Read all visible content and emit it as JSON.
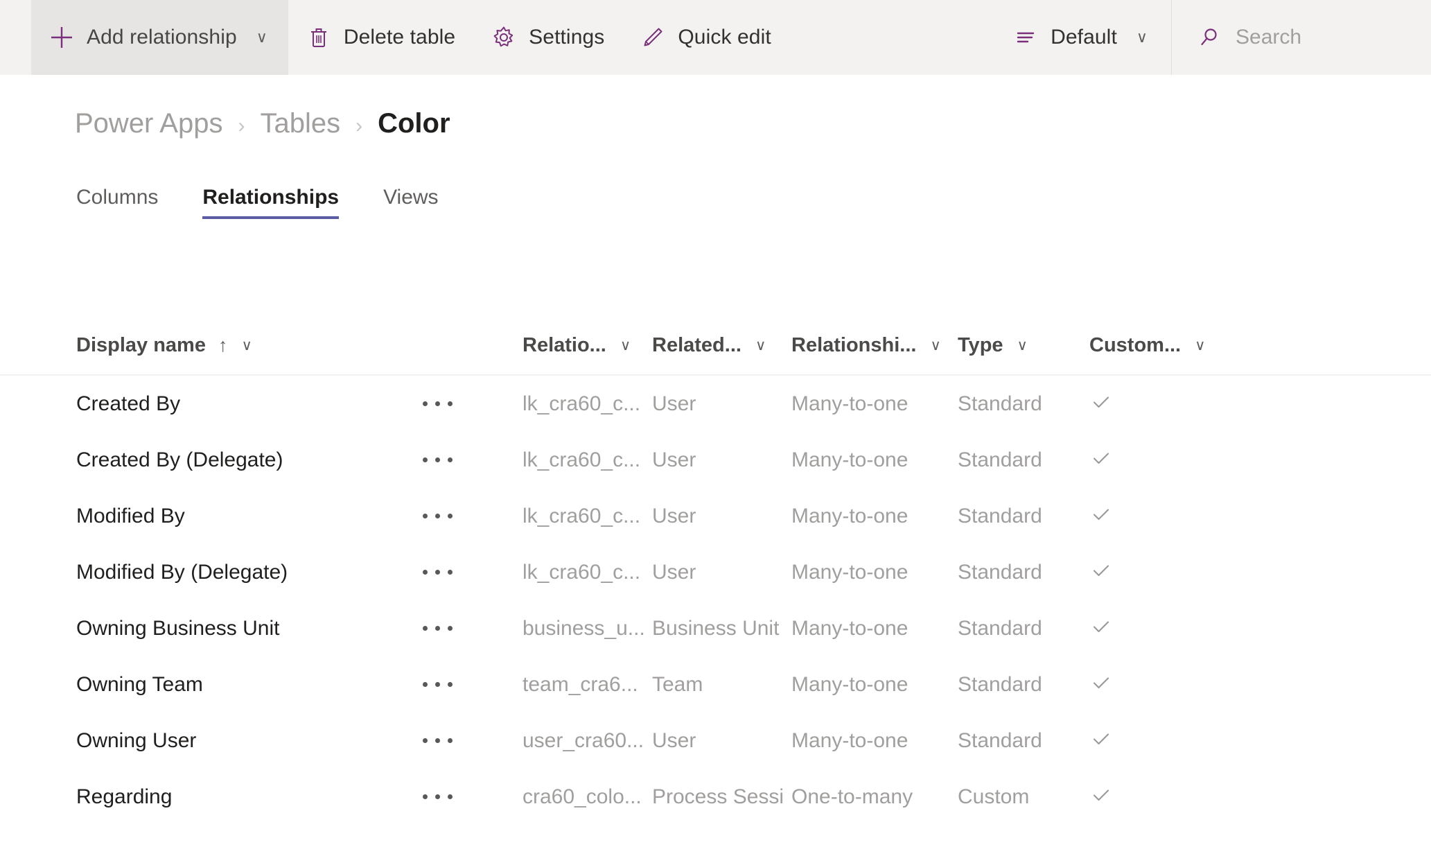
{
  "commandbar": {
    "add_relationship": {
      "label": "Add relationship",
      "icon": "plus-icon",
      "caret": "∨"
    },
    "delete_table": {
      "label": "Delete table",
      "icon": "trash-icon"
    },
    "settings": {
      "label": "Settings",
      "icon": "gear-icon"
    },
    "quick_edit": {
      "label": "Quick edit",
      "icon": "pencil-icon"
    },
    "view_picker": {
      "label": "Default",
      "icon": "view-list-icon",
      "caret": "∨"
    },
    "search": {
      "placeholder": "Search",
      "icon": "search-icon"
    },
    "accent_color": "#7a2f7a",
    "background": "#f3f2f1"
  },
  "breadcrumb": {
    "items": [
      {
        "label": "Power Apps",
        "current": false
      },
      {
        "label": "Tables",
        "current": false
      },
      {
        "label": "Color",
        "current": true
      }
    ],
    "separator": "›"
  },
  "tabs": {
    "items": [
      {
        "label": "Columns",
        "active": false
      },
      {
        "label": "Relationships",
        "active": true
      },
      {
        "label": "Views",
        "active": false
      }
    ],
    "active_underline_color": "#5c5ca5"
  },
  "grid": {
    "columns": [
      {
        "key": "display_name",
        "label": "Display name",
        "sorted": true,
        "sort_arrow": "↑",
        "caret": "∨"
      },
      {
        "key": "relationship_name",
        "label": "Relatio...",
        "caret": "∨"
      },
      {
        "key": "related_table",
        "label": "Related...",
        "caret": "∨"
      },
      {
        "key": "relationship_type",
        "label": "Relationshi...",
        "caret": "∨"
      },
      {
        "key": "type",
        "label": "Type",
        "caret": "∨"
      },
      {
        "key": "customizable",
        "label": "Custom...",
        "caret": "∨"
      }
    ],
    "row_menu_label": "···",
    "check_glyph": "✓",
    "rows": [
      {
        "display_name": "Created By",
        "relationship_name": "lk_cra60_c...",
        "related_table": "User",
        "relationship_type": "Many-to-one",
        "type": "Standard",
        "customizable": true
      },
      {
        "display_name": "Created By (Delegate)",
        "relationship_name": "lk_cra60_c...",
        "related_table": "User",
        "relationship_type": "Many-to-one",
        "type": "Standard",
        "customizable": true
      },
      {
        "display_name": "Modified By",
        "relationship_name": "lk_cra60_c...",
        "related_table": "User",
        "relationship_type": "Many-to-one",
        "type": "Standard",
        "customizable": true
      },
      {
        "display_name": "Modified By (Delegate)",
        "relationship_name": "lk_cra60_c...",
        "related_table": "User",
        "relationship_type": "Many-to-one",
        "type": "Standard",
        "customizable": true
      },
      {
        "display_name": "Owning Business Unit",
        "relationship_name": "business_u...",
        "related_table": "Business Unit",
        "relationship_type": "Many-to-one",
        "type": "Standard",
        "customizable": true
      },
      {
        "display_name": "Owning Team",
        "relationship_name": "team_cra6...",
        "related_table": "Team",
        "relationship_type": "Many-to-one",
        "type": "Standard",
        "customizable": true
      },
      {
        "display_name": "Owning User",
        "relationship_name": "user_cra60...",
        "related_table": "User",
        "relationship_type": "Many-to-one",
        "type": "Standard",
        "customizable": true
      },
      {
        "display_name": "Regarding",
        "relationship_name": "cra60_colo...",
        "related_table": "Process Sessi",
        "relationship_type": "One-to-many",
        "type": "Custom",
        "customizable": true
      }
    ]
  }
}
